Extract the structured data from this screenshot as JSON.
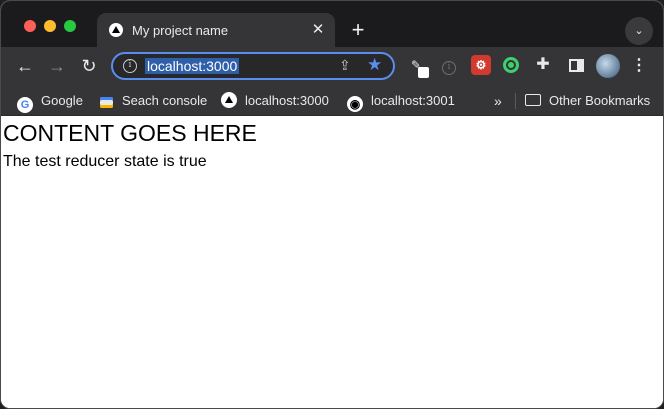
{
  "tab": {
    "title": "My project name",
    "close": "✕"
  },
  "tabstrip": {
    "new_tab": "+",
    "tab_search": "⌄"
  },
  "toolbar": {
    "back": "←",
    "forward": "→",
    "reload": "↻",
    "info_glyph": "i",
    "url": "localhost:3000",
    "share": "⇪",
    "star": "★",
    "menu": "⋮"
  },
  "bookmarks": {
    "items": [
      {
        "label": "Google",
        "glyph": "G"
      },
      {
        "label": "Seach console",
        "glyph": ""
      },
      {
        "label": "localhost:3000",
        "glyph": ""
      },
      {
        "label": "localhost:3001",
        "glyph": "◉"
      }
    ],
    "more": "»",
    "other": "Other Bookmarks"
  },
  "page": {
    "heading": "CONTENT GOES HERE",
    "text": "The test reducer state is true"
  },
  "colors": {
    "accent": "#5b8def",
    "tab_bg": "#353538",
    "strip_bg": "#1b1b1d"
  }
}
